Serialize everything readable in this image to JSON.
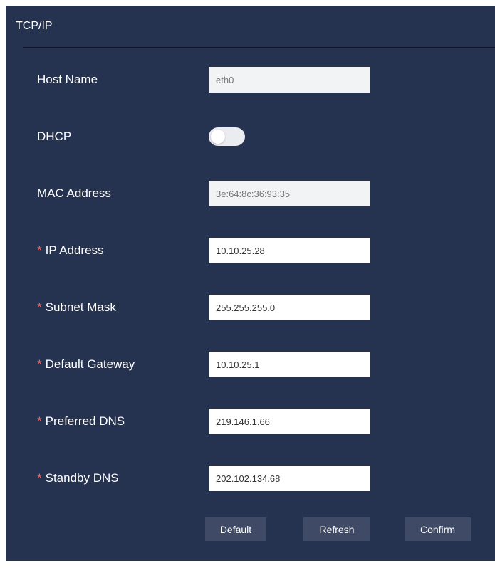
{
  "panel": {
    "title": "TCP/IP"
  },
  "form": {
    "host_name": {
      "label": "Host Name",
      "placeholder": "eth0",
      "value": ""
    },
    "dhcp": {
      "label": "DHCP",
      "enabled": false
    },
    "mac_address": {
      "label": "MAC Address",
      "placeholder": "3e:64:8c:36:93:35",
      "value": ""
    },
    "ip_address": {
      "required_mark": "*",
      "label": "IP Address",
      "value": "10.10.25.28"
    },
    "subnet_mask": {
      "required_mark": "*",
      "label": "Subnet Mask",
      "value": "255.255.255.0"
    },
    "default_gateway": {
      "required_mark": "*",
      "label": "Default Gateway",
      "value": "10.10.25.1"
    },
    "preferred_dns": {
      "required_mark": "*",
      "label": "Preferred DNS",
      "value": "219.146.1.66"
    },
    "standby_dns": {
      "required_mark": "*",
      "label": "Standby DNS",
      "value": "202.102.134.68"
    }
  },
  "buttons": {
    "default_label": "Default",
    "refresh_label": "Refresh",
    "confirm_label": "Confirm"
  },
  "colors": {
    "panel_background": "#253250",
    "required_mark": "#f56c6c",
    "button_background": "#3e4a66",
    "disabled_input": "#f2f3f5"
  }
}
